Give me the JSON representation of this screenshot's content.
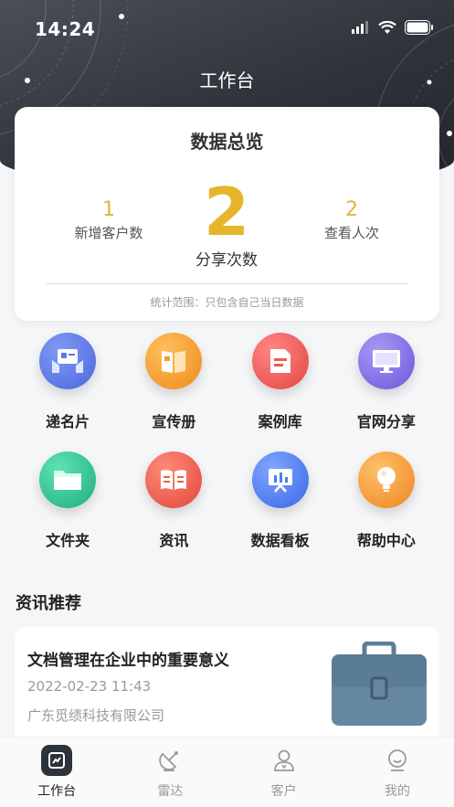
{
  "status_bar": {
    "time": "14:24"
  },
  "header": {
    "title": "工作台"
  },
  "overview": {
    "title": "数据总览",
    "new_customers": {
      "value": "1",
      "label": "新增客户数"
    },
    "shares": {
      "value": "2",
      "label": "分享次数"
    },
    "views": {
      "value": "2",
      "label": "查看人次"
    },
    "note": "统计范围：只包含自己当日数据"
  },
  "menu": {
    "items": [
      {
        "label": "递名片",
        "icon": "business-card-icon",
        "color": "#5a76e6"
      },
      {
        "label": "宣传册",
        "icon": "brochure-icon",
        "color": "#f29a2e"
      },
      {
        "label": "案例库",
        "icon": "case-library-icon",
        "color": "#ec5a57"
      },
      {
        "label": "官网分享",
        "icon": "website-share-icon",
        "color": "#7b6ae6"
      },
      {
        "label": "文件夹",
        "icon": "folder-icon",
        "color": "#2fc28e"
      },
      {
        "label": "资讯",
        "icon": "news-icon",
        "color": "#ee5e4c"
      },
      {
        "label": "数据看板",
        "icon": "dashboard-icon",
        "color": "#4b7ef0"
      },
      {
        "label": "帮助中心",
        "icon": "help-center-icon",
        "color": "#f39a34"
      }
    ]
  },
  "news_section": {
    "title": "资讯推荐",
    "article": {
      "title": "文档管理在企业中的重要意义",
      "date": "2022-02-23 11:43",
      "source": "广东觅绩科技有限公司",
      "thumbnail": "briefcase-icon"
    }
  },
  "tab_bar": {
    "tabs": [
      {
        "label": "工作台",
        "icon": "workbench-icon",
        "active": true
      },
      {
        "label": "雷达",
        "icon": "radar-icon",
        "active": false
      },
      {
        "label": "客户",
        "icon": "customer-icon",
        "active": false
      },
      {
        "label": "我的",
        "icon": "profile-icon",
        "active": false
      }
    ]
  }
}
